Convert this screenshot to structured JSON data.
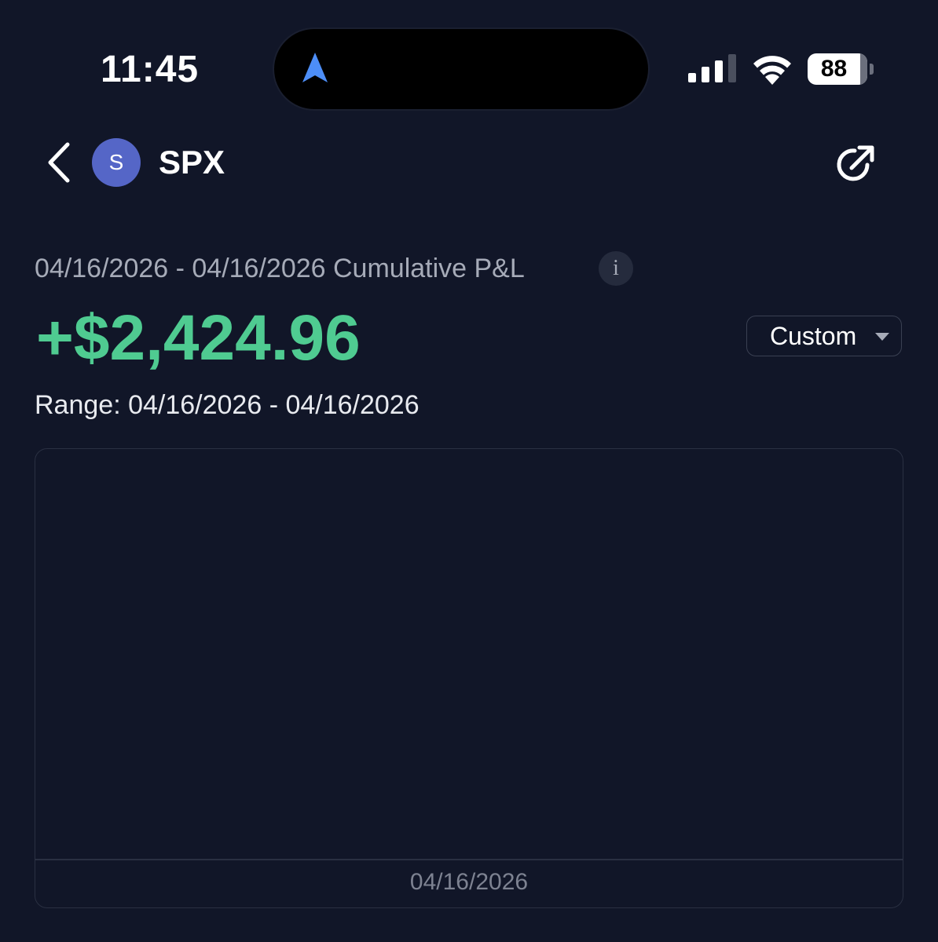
{
  "status_bar": {
    "time": "11:45",
    "battery_level": "88",
    "icons": [
      "navigation-arrow-icon",
      "cellular-signal-icon",
      "wifi-icon",
      "battery-icon"
    ]
  },
  "header": {
    "avatar_letter": "S",
    "symbol": "SPX",
    "icons": [
      "chevron-left-icon",
      "share-icon"
    ]
  },
  "pnl": {
    "period_label": "04/16/2026 - 04/16/2026 Cumulative P&L",
    "info_glyph": "i",
    "value": "+$2,424.96",
    "value_color": "#4fcb91",
    "range_select_value": "Custom",
    "range_text": "Range: 04/16/2026 - 04/16/2026"
  },
  "chart_data": {
    "type": "line",
    "categories": [
      "04/16/2026"
    ],
    "series": [],
    "grid": false
  },
  "colors": {
    "background": "#111628",
    "accent_green": "#4fcb91",
    "avatar": "#5566c7",
    "nav_arrow": "#4d8ef7"
  }
}
